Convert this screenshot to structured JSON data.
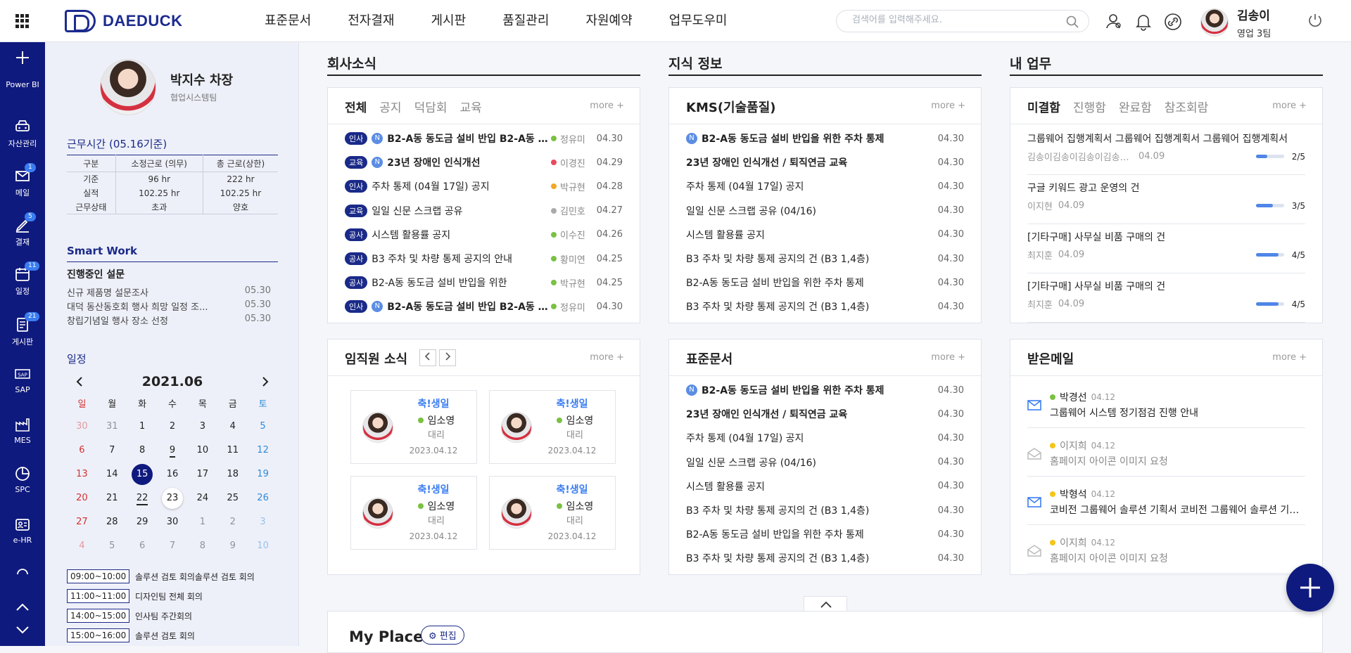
{
  "header": {
    "logo_text": "DAEDUCK",
    "menu": [
      "표준문서",
      "전자결재",
      "게시판",
      "품질관리",
      "자원예약",
      "업무도우미"
    ],
    "search_placeholder": "검색어를 입력해주세요.",
    "user_name": "김송이",
    "user_team": "영업 3팀"
  },
  "leftnav": {
    "items": [
      {
        "label": "Power BI",
        "icon": "plus-icon"
      },
      {
        "label": "자산관리",
        "icon": "car-icon"
      },
      {
        "label": "메일",
        "icon": "mail-icon",
        "badge": "1"
      },
      {
        "label": "결재",
        "icon": "pen-icon",
        "badge": "5"
      },
      {
        "label": "일정",
        "icon": "calendar-icon",
        "badge": "11"
      },
      {
        "label": "게시판",
        "icon": "board-icon",
        "badge": "21"
      },
      {
        "label": "SAP",
        "icon": "sap-icon"
      },
      {
        "label": "MES",
        "icon": "factory-icon"
      },
      {
        "label": "SPC",
        "icon": "chart-icon"
      },
      {
        "label": "e-HR",
        "icon": "id-card-icon"
      }
    ]
  },
  "profile": {
    "name": "박지수 차장",
    "team": "협업시스템팀"
  },
  "worktime": {
    "title": "근무시간 (05.16기준)",
    "headers": [
      "구분",
      "소정근로 (의무)",
      "총 근로(상한)"
    ],
    "rows": [
      [
        "기준",
        "96 hr",
        "222 hr"
      ],
      [
        "실적",
        "102.25 hr",
        "102.25 hr"
      ],
      [
        "근무상태",
        "초과",
        "양호"
      ]
    ]
  },
  "smartwork": {
    "title": "Smart Work",
    "subtitle": "진행중인 설문",
    "items": [
      {
        "title": "신규 제품명 설문조사",
        "date": "05.30"
      },
      {
        "title": "대덕 동산동호회 행사 희망 일정 조...",
        "date": "05.30"
      },
      {
        "title": "창립기념일 행사 장소 선정",
        "date": "05.30"
      }
    ]
  },
  "calendar": {
    "title": "일정",
    "month": "2021.06",
    "dow": [
      "일",
      "월",
      "화",
      "수",
      "목",
      "금",
      "토"
    ],
    "weeks": [
      [
        "30",
        "31",
        "1",
        "2",
        "3",
        "4",
        "5"
      ],
      [
        "6",
        "7",
        "8",
        "9",
        "10",
        "11",
        "12"
      ],
      [
        "13",
        "14",
        "15",
        "16",
        "17",
        "18",
        "19"
      ],
      [
        "20",
        "21",
        "22",
        "23",
        "24",
        "25",
        "26"
      ],
      [
        "27",
        "28",
        "29",
        "30",
        "1",
        "2",
        "3"
      ],
      [
        "4",
        "5",
        "6",
        "7",
        "8",
        "9",
        "10"
      ]
    ],
    "today": "15",
    "schedules": [
      {
        "time": "09:00~10:00",
        "title": "솔루션 검토 회의솔루션 검토 회의"
      },
      {
        "time": "11:00~11:00",
        "title": "디자인팀 전체 회의"
      },
      {
        "time": "14:00~15:00",
        "title": "인사팀 주간회의"
      },
      {
        "time": "15:00~16:00",
        "title": "솔루션 검토 회의"
      }
    ]
  },
  "news": {
    "section_title": "회사소식",
    "tabs": [
      "전체",
      "공지",
      "덕담회",
      "교육"
    ],
    "more": "more +",
    "rows": [
      {
        "tag": "인사",
        "new": true,
        "title": "B2-A동 동도금 설비 반입 B2-A동 동도금",
        "bold": true,
        "author": "정유미",
        "dot": "#7ac143",
        "date": "04.30"
      },
      {
        "tag": "교육",
        "new": true,
        "title": "23년 장애인 인식개선",
        "bold": true,
        "author": "이경진",
        "dot": "#e84a5f",
        "date": "04.29"
      },
      {
        "tag": "인사",
        "new": false,
        "title": "주차 통제 (04월 17일) 공지",
        "bold": false,
        "author": "박규현",
        "dot": "#f5a623",
        "date": "04.28"
      },
      {
        "tag": "교육",
        "new": false,
        "title": "일일 신문 스크랩 공유",
        "bold": false,
        "author": "김민호",
        "dot": "#aaaaaa",
        "date": "04.27"
      },
      {
        "tag": "공사",
        "new": false,
        "title": "시스템 활용률 공지",
        "bold": false,
        "author": "이수진",
        "dot": "#7ac143",
        "date": "04.26"
      },
      {
        "tag": "공사",
        "new": false,
        "title": "B3 주차 및 차량 통제 공지의 안내",
        "bold": false,
        "author": "황미연",
        "dot": "#7ac143",
        "date": "04.25"
      },
      {
        "tag": "공사",
        "new": false,
        "title": "B2-A동 동도금 설비 반입을 위한",
        "bold": false,
        "author": "박규현",
        "dot": "#7ac143",
        "date": "04.25"
      },
      {
        "tag": "인사",
        "new": true,
        "title": "B2-A동 동도금 설비 반입 B2-A동 동도금",
        "bold": true,
        "author": "정유미",
        "dot": "#7ac143",
        "date": "04.30"
      }
    ]
  },
  "knowledge": {
    "section_title": "지식 정보",
    "card_title": "KMS(기술품질)",
    "more": "more +",
    "rows": [
      {
        "new": true,
        "title": "B2-A동 동도금 설비 반입을 위한 주차 통제",
        "bold": true,
        "date": "04.30"
      },
      {
        "new": false,
        "title": "23년 장애인 인식개선 / 퇴직연금 교육",
        "bold": true,
        "date": "04.30"
      },
      {
        "new": false,
        "title": "주차 통제 (04월 17일) 공지",
        "bold": false,
        "date": "04.30"
      },
      {
        "new": false,
        "title": "일일 신문 스크랩 공유 (04/16)",
        "bold": false,
        "date": "04.30"
      },
      {
        "new": false,
        "title": "시스템 활용률 공지",
        "bold": false,
        "date": "04.30"
      },
      {
        "new": false,
        "title": "B3 주차 및 차량 통제 공지의 건 (B3 1,4층)",
        "bold": false,
        "date": "04.30"
      },
      {
        "new": false,
        "title": "B2-A동 동도금 설비 반입을 위한 주차 통제",
        "bold": false,
        "date": "04.30"
      },
      {
        "new": false,
        "title": "B3 주차 및 차량 통제 공지의 건 (B3 1,4층)",
        "bold": false,
        "date": "04.30"
      }
    ]
  },
  "mywork": {
    "section_title": "내 업무",
    "tabs": [
      "미결함",
      "진행함",
      "완료함",
      "참조회람"
    ],
    "more": "more +",
    "items": [
      {
        "title": "그룹웨어 집행계획서 그룹웨어 집행계획서 그룹웨어 집행계획서",
        "who": "김송이김송이김송이김송이김송이김송이",
        "date": "04.09",
        "progress": 0.4,
        "label": "2/5"
      },
      {
        "title": "구글 키워드 광고 운영의 건",
        "who": "이지현",
        "date": "04.09",
        "progress": 0.6,
        "label": "3/5"
      },
      {
        "title": "[기타구매] 사무실 비품 구매의 건",
        "who": "최지훈",
        "date": "04.09",
        "progress": 0.8,
        "label": "4/5"
      },
      {
        "title": "[기타구매] 사무실 비품 구매의 건",
        "who": "최지훈",
        "date": "04.09",
        "progress": 0.8,
        "label": "4/5"
      }
    ]
  },
  "employees": {
    "card_title": "임직원 소식",
    "more": "more +",
    "cards": [
      {
        "heading": "축!생일",
        "name": "임소영",
        "rank": "대리",
        "date": "2023.04.12"
      },
      {
        "heading": "축!생일",
        "name": "임소영",
        "rank": "대리",
        "date": "2023.04.12"
      },
      {
        "heading": "축!생일",
        "name": "임소영",
        "rank": "대리",
        "date": "2023.04.12"
      },
      {
        "heading": "축!생일",
        "name": "임소영",
        "rank": "대리",
        "date": "2023.04.12"
      }
    ]
  },
  "standard": {
    "card_title": "표준문서",
    "more": "more +",
    "rows": [
      {
        "new": true,
        "title": "B2-A동 동도금 설비 반입을 위한 주차 통제",
        "bold": true,
        "date": "04.30"
      },
      {
        "new": false,
        "title": "23년 장애인 인식개선 / 퇴직연금 교육",
        "bold": true,
        "date": "04.30"
      },
      {
        "new": false,
        "title": "주차 통제 (04월 17일) 공지",
        "bold": false,
        "date": "04.30"
      },
      {
        "new": false,
        "title": "일일 신문 스크랩 공유 (04/16)",
        "bold": false,
        "date": "04.30"
      },
      {
        "new": false,
        "title": "시스템 활용률 공지",
        "bold": false,
        "date": "04.30"
      },
      {
        "new": false,
        "title": "B3 주차 및 차량 통제 공지의 건 (B3 1,4층)",
        "bold": false,
        "date": "04.30"
      },
      {
        "new": false,
        "title": "B2-A동 동도금 설비 반입을 위한 주차 통제",
        "bold": false,
        "date": "04.30"
      },
      {
        "new": false,
        "title": "B3 주차 및 차량 통제 공지의 건 (B3 1,4층)",
        "bold": false,
        "date": "04.30"
      }
    ]
  },
  "mail": {
    "card_title": "받은메일",
    "more": "more +",
    "items": [
      {
        "sender": "박경선",
        "date": "04.12",
        "subject": "그룹웨어 시스템 정기점검 진행 안내",
        "read": false,
        "dot": "#7ac143"
      },
      {
        "sender": "이지희",
        "date": "04.12",
        "subject": "홈페이지 아이콘 이미지 요청",
        "read": true,
        "dot": "#f5c518"
      },
      {
        "sender": "박형석",
        "date": "04.12",
        "subject": "코비전 그룹웨어 솔루션 기획서 코비전 그룹웨어 솔루션 기획서",
        "read": false,
        "dot": "#f5c518"
      },
      {
        "sender": "이지희",
        "date": "04.12",
        "subject": "홈페이지 아이콘 이미지 요청",
        "read": true,
        "dot": "#f5c518"
      }
    ]
  },
  "myplace": {
    "title": "My Place",
    "edit": "편집"
  }
}
